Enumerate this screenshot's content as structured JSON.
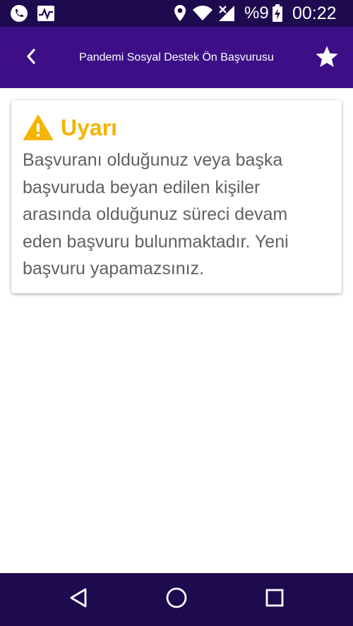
{
  "status_bar": {
    "battery_text": "%9",
    "time": "00:22",
    "icons": [
      "phone-call-icon",
      "activity-monitor-icon",
      "location-pin-icon",
      "wifi-icon",
      "no-signal-icon",
      "battery-charging-icon"
    ]
  },
  "app_bar": {
    "title": "Pandemi Sosyal Destek Ön Başvurusu",
    "back_icon": "chevron-left-icon",
    "favorite_icon": "star-icon"
  },
  "warning_card": {
    "icon": "warning-triangle-icon",
    "title": "Uyarı",
    "message": "Başvuranı olduğunuz veya başka başvuruda beyan edilen kişiler arasında olduğunuz süreci devam eden başvuru bulunmaktadır. Yeni başvuru yapamazsınız."
  },
  "nav_bar": {
    "icons": [
      "back-triangle-icon",
      "home-circle-icon",
      "recents-square-icon"
    ]
  },
  "colors": {
    "status_bar": "#1e0a4e",
    "app_bar": "#3c0f87",
    "nav_bar": "#1e0a4e",
    "warning_accent": "#f4b400",
    "body_text": "#616161"
  }
}
